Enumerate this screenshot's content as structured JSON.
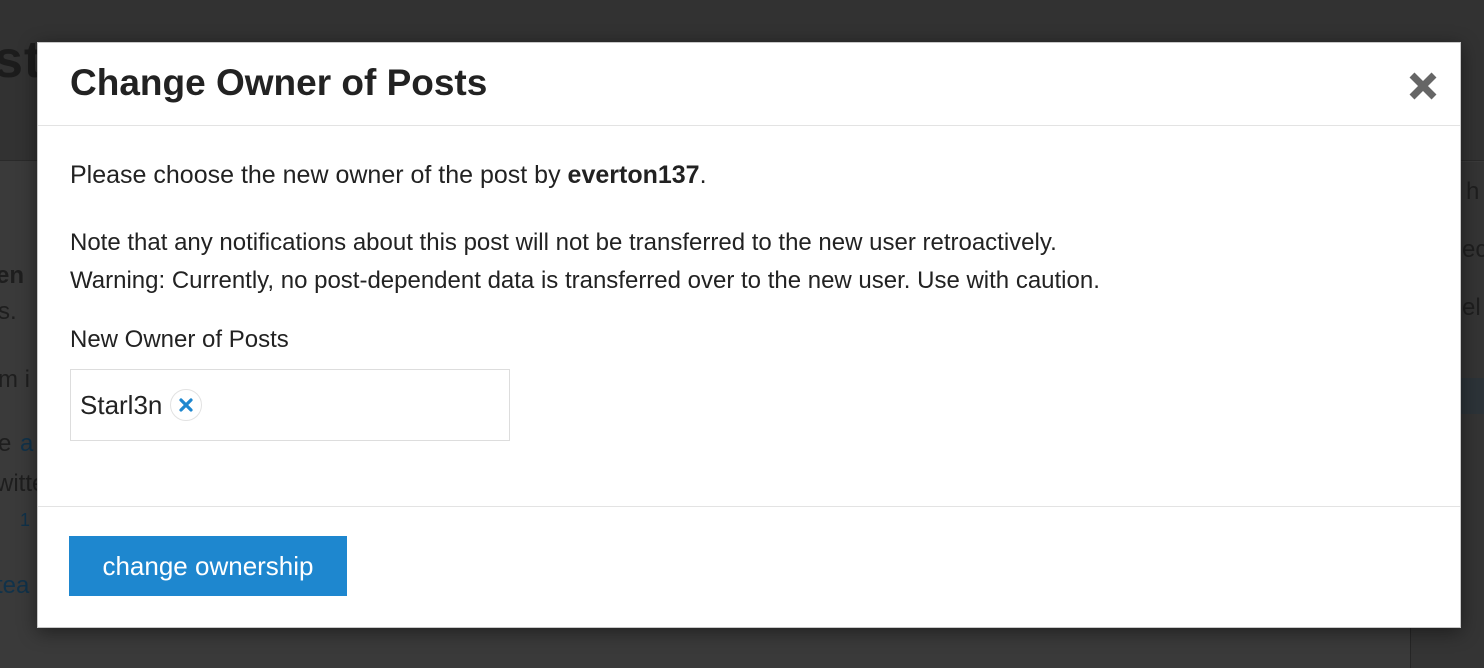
{
  "background": {
    "title_fragment": "st",
    "fragments": [
      "en",
      "s.",
      "m i",
      "e",
      "a",
      "witte",
      "1",
      "tea"
    ],
    "side_fragments": [
      "h",
      "ec",
      "el"
    ]
  },
  "modal": {
    "title": "Change Owner of Posts",
    "close_icon": "close-icon",
    "intro_prefix": "Please choose the new owner of the post by ",
    "intro_user": "everton137",
    "intro_suffix": ".",
    "note_line1": "Note that any notifications about this post will not be transferred to the new user retroactively.",
    "note_line2": "Warning: Currently, no post-dependent data is transferred over to the new user. Use with caution.",
    "field_label": "New Owner of Posts",
    "selected_user": "Starl3n",
    "chip_remove_icon": "remove-icon",
    "submit_label": "change ownership"
  },
  "colors": {
    "primary": "#1e87cf",
    "overlay": "#2e2e2e"
  }
}
